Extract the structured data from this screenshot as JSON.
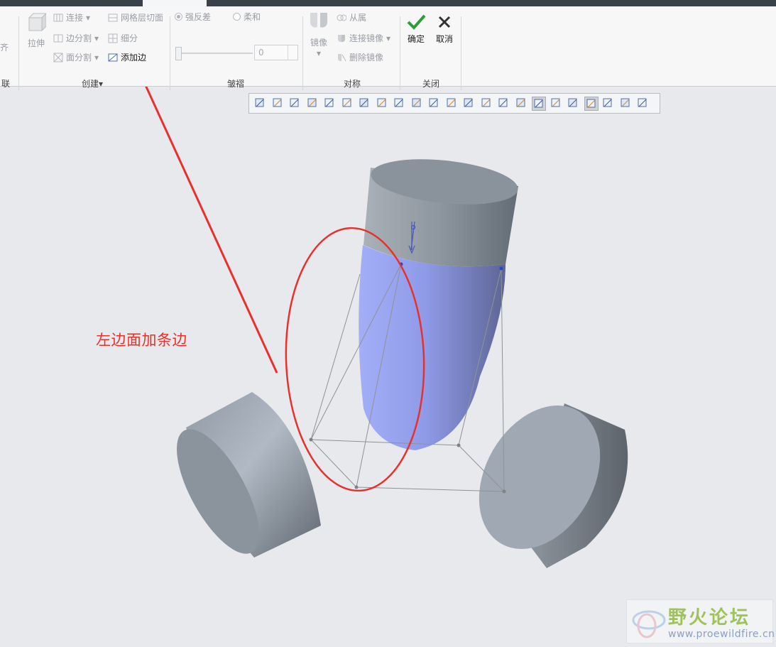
{
  "ribbon": {
    "left_partial": {
      "item": "齐",
      "group_label": "联"
    },
    "create": {
      "extrude_label": "拉伸",
      "connect_label": "连接",
      "mesh_cut_label": "网格层切面",
      "edge_split_label": "边分割",
      "subdivide_label": "细分",
      "face_split_label": "面分割",
      "add_edge_label": "添加边",
      "group_label": "创建"
    },
    "crease": {
      "strong_label": "强反差",
      "soft_label": "柔和",
      "value": "0",
      "group_label": "皱褶"
    },
    "symmetry": {
      "mirror_label": "镜像",
      "slave_label": "从属",
      "connect_mirror_label": "连接镜像",
      "delete_mirror_label": "删除镜像",
      "group_label": "对称"
    },
    "close": {
      "ok_label": "确定",
      "cancel_label": "取消",
      "group_label": "关闭"
    }
  },
  "annotation": {
    "text": "左边面加条边",
    "color": "#e8312a"
  },
  "watermark": {
    "title": "野火论坛",
    "url": "www.proewildfire.cn"
  },
  "view_toolbar": {
    "icons": [
      "refit-icon",
      "zoom-in-icon",
      "zoom-out-icon",
      "repaint-icon",
      "spin-center-icon",
      "shading-icon",
      "view-manager-icon",
      "saved-views-icon",
      "display-style-icon",
      "plane-display-icon",
      "axis-display-icon",
      "point-display-icon",
      "csys-display-icon",
      "annotation-display-icon",
      "spin-icon",
      "box-icon",
      "wire-icon",
      "show-cage-icon",
      "connect-icon",
      "frame-icon",
      "hidden-line-icon",
      "perspective-icon",
      "dynamic-icon"
    ]
  }
}
